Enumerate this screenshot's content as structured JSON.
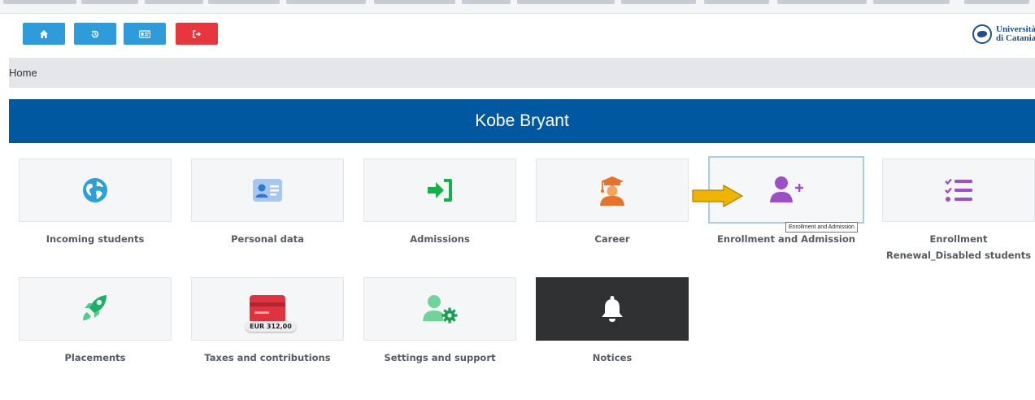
{
  "topbar": {
    "buttons": [
      {
        "name": "home-button",
        "icon": "home-icon"
      },
      {
        "name": "history-button",
        "icon": "history-icon"
      },
      {
        "name": "card-button",
        "icon": "id-card-icon"
      },
      {
        "name": "logout-button",
        "icon": "sign-out-icon"
      }
    ],
    "logo": {
      "line1": "Università",
      "line2": "di Catania"
    }
  },
  "breadcrumb": {
    "home": "Home"
  },
  "header": {
    "student_name": "Kobe Bryant"
  },
  "tiles": [
    {
      "label": "Incoming students",
      "icon": "globe-icon"
    },
    {
      "label": "Personal data",
      "icon": "id-card-icon"
    },
    {
      "label": "Admissions",
      "icon": "sign-in-icon"
    },
    {
      "label": "Career",
      "icon": "graduate-icon"
    },
    {
      "label": "Enrollment and Admission",
      "icon": "user-plus-icon"
    },
    {
      "label": "Enrollment Renewal_Disabled students",
      "icon": "checklist-icon"
    },
    {
      "label": "Placements",
      "icon": "rocket-icon"
    },
    {
      "label": "Taxes and contributions",
      "icon": "credit-card-icon",
      "badge": "EUR 312,00"
    },
    {
      "label": "Settings and support",
      "icon": "user-gear-icon"
    },
    {
      "label": "Notices",
      "icon": "bell-icon"
    }
  ],
  "tooltip": "Enrollment and Admission",
  "colors": {
    "header": "#0059a0",
    "button_blue": "#2e9cdb",
    "button_red": "#e8363e",
    "arrow": "#f0b400"
  }
}
